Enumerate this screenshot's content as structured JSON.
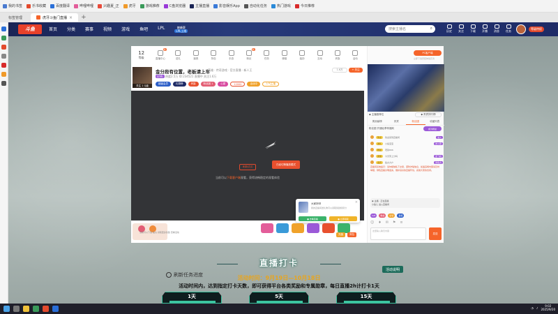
{
  "bookmarks": [
    "我的书签",
    "乐书收藏",
    "百度翻译",
    "哔哩哔哩",
    "兴趣夏_正",
    "虎牙",
    "游戏推荐",
    "C盘浏览器",
    "主播直播",
    "影音娱乐App",
    "自动化任务",
    "热门游戏",
    "今日推荐"
  ],
  "tabs": {
    "home": "标签管理",
    "active": "虎牙斗鱼门直播",
    "close": "×",
    "plus": "+"
  },
  "header": {
    "logo": "斗鱼",
    "nav": [
      "首页",
      "分类",
      "赛事",
      "视频",
      "游戏",
      "鱼吧",
      "LPL"
    ],
    "hot_top": "巅峰赛",
    "hot_bottom": "LPL上线",
    "search_placeholder": "搜索主播名",
    "search_icon": "⌕",
    "icons": [
      "历史",
      "关注",
      "下载",
      "开播",
      "消息",
      "任务"
    ],
    "vip": "等级特权"
  },
  "toolbar": {
    "level_num": "12",
    "level_label": "等级",
    "items": [
      "直播中心",
      "送礼",
      "道具",
      "背包",
      "手游",
      "粉丝",
      "任务",
      "弹幕",
      "装扮",
      "互动",
      "贵族",
      "活动",
      "抽奖",
      "更多"
    ],
    "dot": "新"
  },
  "anchor": {
    "lvl": "关注 1 Q级",
    "title": "金分段有位置，老板请上车",
    "tags": "英雄 · 传奇游戏 · 官方直播 · 新人王",
    "meta_live": "LIVE",
    "meta": "热度2.5万  ID:234521  直播中  关注1.6万",
    "follow_count": "1.6万",
    "follow_btn": "+ 关注",
    "badges": [
      "超级会员",
      "礼物榜",
      "贵族",
      "粉丝团 1",
      "心愿",
      "12000",
      "活动中",
      "人气主播"
    ]
  },
  "player": {
    "err_pre": "当前可以",
    "err_hl": "下载客户端",
    "err_post": "观看，获得流畅稳定的观看体验",
    "refresh_btn": "刷新试试",
    "switch_btn": "已经切换播放模式",
    "popup_name": "大家好呀",
    "popup_desc": "我的直播间送礼物可以领取奖励和积分",
    "popup_close": "×",
    "popup_btn1": "● 去看直播",
    "popup_btn2": "● 立即领取"
  },
  "gift_bar": {
    "note": "当前可以下载 鱼丸 领取更多奖励 查看活动",
    "actions": [
      "充值",
      "背包"
    ]
  },
  "right": {
    "pc_btn": "PC客户端",
    "pc_sub": "立即下载安装体验高清",
    "live_label": "◆ 主播推荐位",
    "rank_btn": "◆ 贵宾排行榜",
    "tabs": [
      "周贡献榜",
      "贵宾",
      "粉丝团",
      "收藏列表"
    ],
    "fans": "粉丝团 开通后享有福利",
    "fans_btn": "成为粉丝",
    "chat": [
      {
        "text": "欢迎来到直播间",
        "tag": "欢迎",
        "right": "进入"
      },
      {
        "text": "小鱼宝宝",
        "tag": "送礼",
        "right": "送火箭"
      },
      {
        "text": "老铁666",
        "tag": "粉丝",
        "right": ""
      },
      {
        "text": "今天带上分吗",
        "tag": "贵族",
        "right": "送飞机"
      },
      {
        "text": "鱼丸大户",
        "tag": "会员",
        "right": "送鱼丸"
      }
    ],
    "notice": "直播间系统提示：请勿相信私下交易，谨防诈骗信息，如遇违规内容请及时举报，绿色直播文明发言，维护良好的直播环境，感谢大家的支持。",
    "enter_line1": "◉ 主播 · 正在直播",
    "enter_line2": "小鱼儿 进入直播间",
    "fan_badges": [
      "LV8",
      "粉丝",
      "房管",
      "贵族"
    ],
    "input_icons": [
      "☺",
      "♦",
      "✉",
      "⚑",
      "≡"
    ],
    "input_placeholder": "这里输入聊天内容",
    "send": "发送"
  },
  "event": {
    "title": "直播打卡",
    "refresh": "刷新任务进度",
    "rules": "活动说明",
    "time": "活动时间：9月19日—10月18日",
    "desc": "活动时间内，达到指定打卡天数，即可获得平台各类奖励和专属勋章，每日直播2h计打卡1天",
    "days": [
      "1天",
      "5天",
      "15天"
    ]
  },
  "taskbar": {
    "time": "9:02",
    "date": "2025/9/20"
  },
  "colors": {
    "accent": "#f5642a",
    "header": "#1a2455",
    "event_green": "#3cc4a0",
    "event_gold": "#e8a51e"
  }
}
